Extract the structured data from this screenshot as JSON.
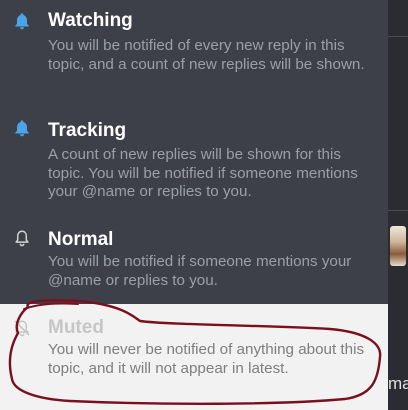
{
  "notification_menu": {
    "items": [
      {
        "title": "Watching",
        "description": "You will be notified of every new reply in this topic, and a count of new replies will be shown.",
        "icon": "bell-icon"
      },
      {
        "title": "Tracking",
        "description": "A count of new replies will be shown for this topic. You will be notified if someone mentions your @name or replies to you.",
        "icon": "bell-icon"
      },
      {
        "title": "Normal",
        "description": "You will be notified if someone mentions your @name or replies to you.",
        "icon": "bell-outline-icon"
      },
      {
        "title": "Muted",
        "description": "You will never be notified of anything about this topic, and it will not appear in latest.",
        "icon": "bell-slash-icon",
        "highlighted": true
      }
    ]
  },
  "background": {
    "partial_text": "ma"
  },
  "colors": {
    "menu_background": "#3d4049",
    "title_text": "#ffffff",
    "description_text": "#9c9fa7",
    "active_bell": "#4da3e8",
    "highlight_background": "#f2f2f2",
    "annotation_stroke": "#7a0f1d"
  }
}
